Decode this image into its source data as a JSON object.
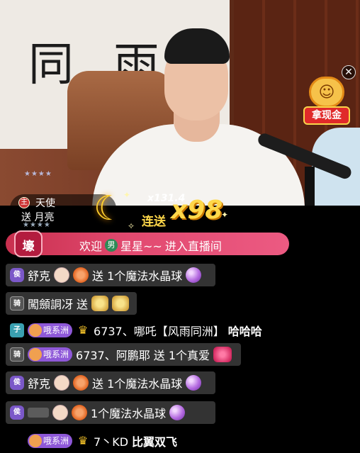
{
  "stream": {
    "wall_text": "同 雨",
    "promo": {
      "label": "拿现金",
      "icon": "lucky-cat-icon",
      "close_icon": "close-icon"
    }
  },
  "gift_combo": {
    "user": "天使",
    "user_prefix": "主",
    "action": "送 月亮",
    "gift_icon": "crescent-moon-icon",
    "multiplier_small": "x131.4",
    "combo_label": "连送",
    "multiplier_big": "x98"
  },
  "welcome": {
    "badge": "壕",
    "prefix": "欢迎",
    "gender": "男",
    "username": "星星~~",
    "suffix": "进入直播间"
  },
  "chat": [
    {
      "level": "侯",
      "user": "舒克",
      "text": "送 1个魔法水晶球",
      "gift": "crystal-ball-icon"
    },
    {
      "level": "骑",
      "user": "闖顩詷冴",
      "text": "送",
      "gift": "rose-gift-icon"
    },
    {
      "level": "子",
      "fan_badge": "哦系洲",
      "user": "6737、哪吒【风雨同洲】",
      "text": "哈哈哈"
    },
    {
      "level": "骑",
      "fan_badge": "哦系洲",
      "user": "6737、阿鹏耶",
      "text": "送 1个真爱",
      "gift": "heart-gift-icon"
    },
    {
      "level": "侯",
      "user": "舒克",
      "text": "送 1个魔法水晶球",
      "gift": "crystal-ball-icon"
    },
    {
      "level": "侯",
      "user": "",
      "text": "1个魔法水晶球",
      "gift": "crystal-ball-icon"
    },
    {
      "level": "",
      "fan_badge": "哦系洲",
      "user": "7丶KD",
      "text": "比翼双飞"
    }
  ]
}
